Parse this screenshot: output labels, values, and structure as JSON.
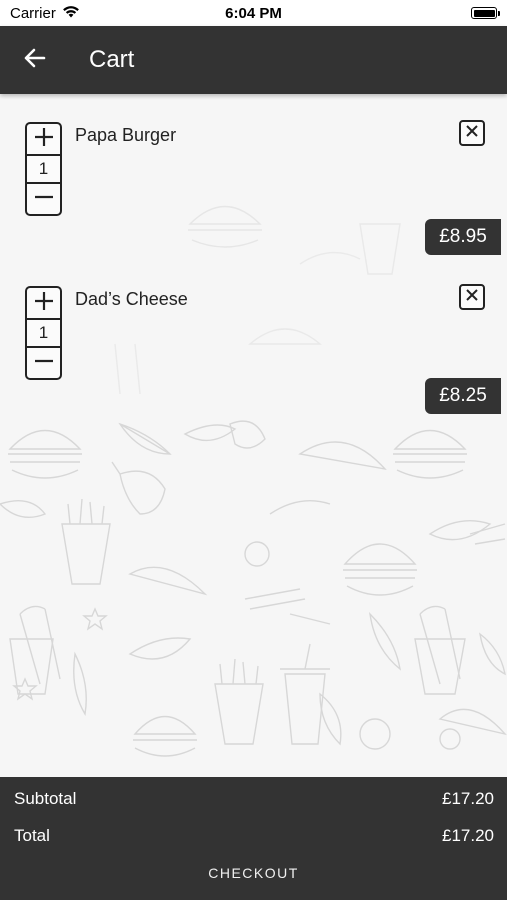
{
  "status_bar": {
    "carrier": "Carrier",
    "time": "6:04 PM"
  },
  "header": {
    "title": "Cart",
    "back_icon": "arrow-left-icon"
  },
  "items": [
    {
      "name": "Papa Burger",
      "quantity": "1",
      "price": "£8.95"
    },
    {
      "name": "Dad’s Cheese",
      "quantity": "1",
      "price": "£8.25"
    }
  ],
  "summary": {
    "subtotal_label": "Subtotal",
    "subtotal_value": "£17.20",
    "total_label": "Total",
    "total_value": "£17.20",
    "checkout_label": "CHECKOUT"
  },
  "colors": {
    "header_bg": "#333333",
    "footer_bg": "#333333",
    "price_badge_bg": "#333333",
    "background": "#f6f6f6"
  }
}
